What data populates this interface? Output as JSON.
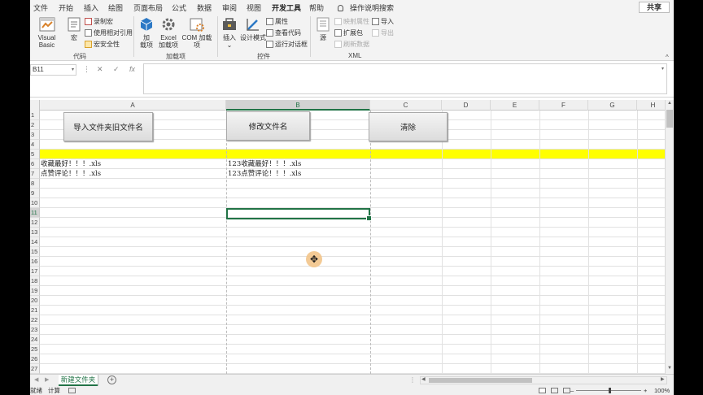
{
  "menu": {
    "tabs": [
      "文件",
      "开始",
      "插入",
      "绘图",
      "页面布局",
      "公式",
      "数据",
      "审阅",
      "视图",
      "开发工具",
      "帮助"
    ],
    "active_tab": "开发工具",
    "tell_me": "操作说明搜索",
    "share": "共享"
  },
  "ribbon": {
    "visual_basic": "Visual Basic",
    "macro": "宏",
    "record_macro": "录制宏",
    "relative_ref": "使用相对引用",
    "macro_security": "宏安全性",
    "group_code": "代码",
    "addins_1": "加",
    "addins_2": "载项",
    "excel_addins_1": "Excel",
    "excel_addins_2": "加载项",
    "com_addins": "COM 加载项",
    "group_addins": "加载项",
    "insert": "插入",
    "insert_arrow": "⌄",
    "design_mode": "设计模式",
    "properties": "属性",
    "view_code": "查看代码",
    "run_dialog": "运行对话框",
    "group_controls": "控件",
    "source": "源",
    "map_props": "映射属性",
    "expansion_packs": "扩展包",
    "refresh_data": "刷新数据",
    "import": "导入",
    "export": "导出",
    "group_xml": "XML",
    "collapse": "^",
    "colors": {
      "accent": "#217346"
    }
  },
  "formula_bar": {
    "name_box": "B11",
    "name_dropdown": "▾",
    "more": "⋮",
    "cancel": "✕",
    "enter": "✓",
    "fx": "fx",
    "value": "",
    "expand": "▾"
  },
  "sheet": {
    "columns": [
      "A",
      "B",
      "C",
      "D",
      "E",
      "F",
      "G",
      "H"
    ],
    "rows": [
      "1",
      "2",
      "3",
      "4",
      "5",
      "6",
      "7",
      "8",
      "9",
      "10",
      "11",
      "12",
      "13",
      "14",
      "15",
      "16",
      "17",
      "18",
      "19",
      "20",
      "21",
      "22",
      "23",
      "24",
      "25",
      "26",
      "27"
    ],
    "selected_cell": "B11",
    "highlight_row": "5",
    "highlight_color": "#ffff00",
    "cells": {
      "A6": "收藏最好！！！.xls",
      "A7": "点赞评论！！！.xls",
      "B6": "123收藏最好！！！.xls",
      "B7": "123点赞评论！！！.xls"
    },
    "buttons": {
      "import_names": "导入文件夹旧文件名",
      "rename_files": "修改文件名",
      "clear": "清除"
    }
  },
  "sheet_tabs": {
    "active": "新建文件夹",
    "add": "+",
    "prev": "◀",
    "next": "▶",
    "dots": "⋮"
  },
  "status_bar": {
    "ready": "就绪",
    "calculate": "计算",
    "zoom_minus": "–",
    "zoom_plus": "+",
    "zoom": "100%"
  }
}
